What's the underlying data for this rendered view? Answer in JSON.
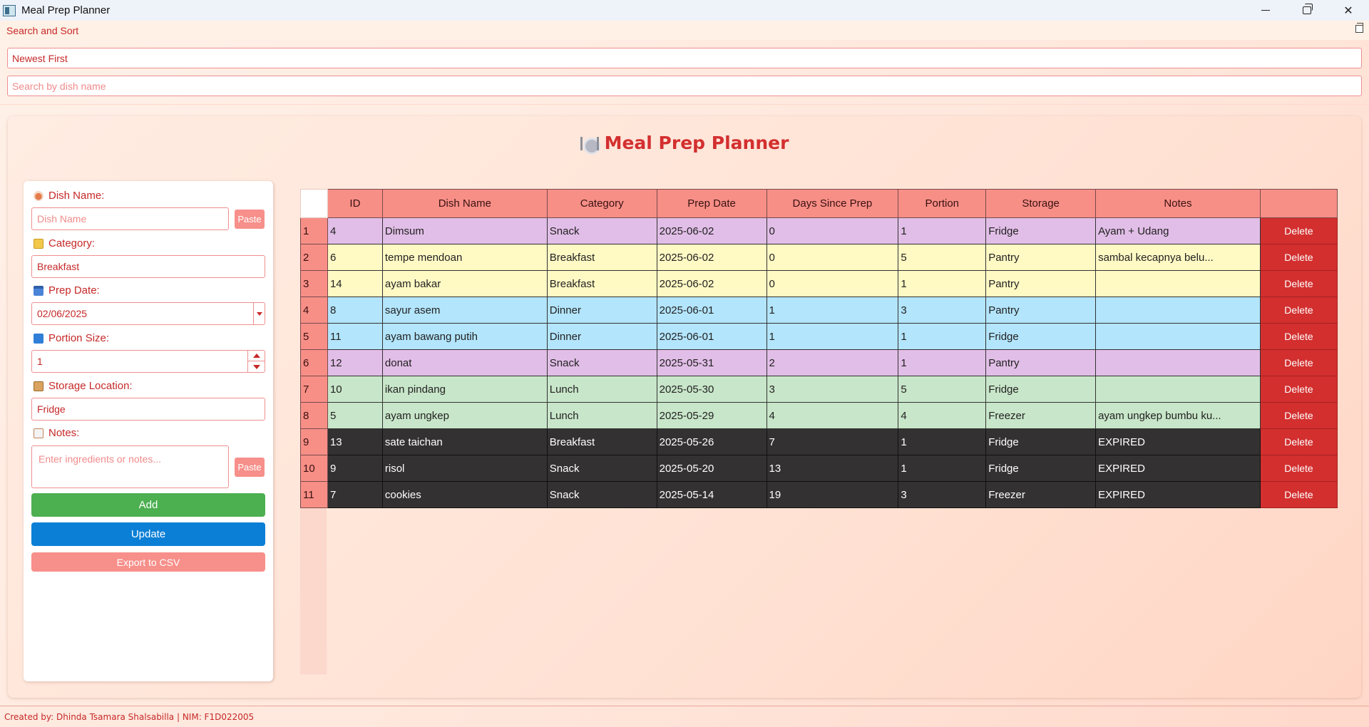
{
  "window": {
    "title": "Meal Prep Planner"
  },
  "dock": {
    "title": "Search and Sort",
    "sort_value": "Newest First",
    "search_placeholder": "Search by dish name"
  },
  "main": {
    "heading": "Meal Prep Planner"
  },
  "form": {
    "dish_label": "Dish Name:",
    "dish_placeholder": "Dish Name",
    "paste_label": "Paste",
    "category_label": "Category:",
    "category_value": "Breakfast",
    "date_label": "Prep Date:",
    "date_value": "02/06/2025",
    "portion_label": "Portion Size:",
    "portion_value": "1",
    "storage_label": "Storage Location:",
    "storage_value": "Fridge",
    "notes_label": "Notes:",
    "notes_placeholder": "Enter ingredients or notes...",
    "add_label": "Add",
    "update_label": "Update",
    "export_label": "Export to CSV"
  },
  "table": {
    "columns": [
      "ID",
      "Dish Name",
      "Category",
      "Prep Date",
      "Days Since Prep",
      "Portion",
      "Storage",
      "Notes",
      ""
    ],
    "delete_label": "Delete",
    "row_colors": {
      "purple": "#e1bee7",
      "yellow": "#fff9c4",
      "blue": "#b3e5fc",
      "green": "#c8e6c9",
      "dark": "#333131"
    },
    "rows": [
      {
        "num": "1",
        "id": "4",
        "dish": "Dimsum",
        "category": "Snack",
        "date": "2025-06-02",
        "days": "0",
        "portion": "1",
        "storage": "Fridge",
        "notes": "Ayam + Udang",
        "color": "purple"
      },
      {
        "num": "2",
        "id": "6",
        "dish": "tempe mendoan",
        "category": "Breakfast",
        "date": "2025-06-02",
        "days": "0",
        "portion": "5",
        "storage": "Pantry",
        "notes": "sambal kecapnya belu...",
        "color": "yellow"
      },
      {
        "num": "3",
        "id": "14",
        "dish": "ayam bakar",
        "category": "Breakfast",
        "date": "2025-06-02",
        "days": "0",
        "portion": "1",
        "storage": "Pantry",
        "notes": "",
        "color": "yellow"
      },
      {
        "num": "4",
        "id": "8",
        "dish": "sayur asem",
        "category": "Dinner",
        "date": "2025-06-01",
        "days": "1",
        "portion": "3",
        "storage": "Pantry",
        "notes": "",
        "color": "blue"
      },
      {
        "num": "5",
        "id": "11",
        "dish": "ayam bawang putih",
        "category": "Dinner",
        "date": "2025-06-01",
        "days": "1",
        "portion": "1",
        "storage": "Fridge",
        "notes": "",
        "color": "blue"
      },
      {
        "num": "6",
        "id": "12",
        "dish": "donat",
        "category": "Snack",
        "date": "2025-05-31",
        "days": "2",
        "portion": "1",
        "storage": "Pantry",
        "notes": "",
        "color": "purple"
      },
      {
        "num": "7",
        "id": "10",
        "dish": "ikan pindang",
        "category": "Lunch",
        "date": "2025-05-30",
        "days": "3",
        "portion": "5",
        "storage": "Fridge",
        "notes": "",
        "color": "green"
      },
      {
        "num": "8",
        "id": "5",
        "dish": "ayam ungkep",
        "category": "Lunch",
        "date": "2025-05-29",
        "days": "4",
        "portion": "4",
        "storage": "Freezer",
        "notes": "ayam ungkep bumbu ku...",
        "color": "green"
      },
      {
        "num": "9",
        "id": "13",
        "dish": "sate taichan",
        "category": "Breakfast",
        "date": "2025-05-26",
        "days": "7",
        "portion": "1",
        "storage": "Fridge",
        "notes": "EXPIRED",
        "color": "dark"
      },
      {
        "num": "10",
        "id": "9",
        "dish": "risol",
        "category": "Snack",
        "date": "2025-05-20",
        "days": "13",
        "portion": "1",
        "storage": "Fridge",
        "notes": "EXPIRED",
        "color": "dark"
      },
      {
        "num": "11",
        "id": "7",
        "dish": "cookies",
        "category": "Snack",
        "date": "2025-05-14",
        "days": "19",
        "portion": "3",
        "storage": "Freezer",
        "notes": "EXPIRED",
        "color": "dark"
      }
    ]
  },
  "footer": {
    "text": "Created by: Dhinda Tsamara Shalsabilla | NIM: F1D022005"
  }
}
